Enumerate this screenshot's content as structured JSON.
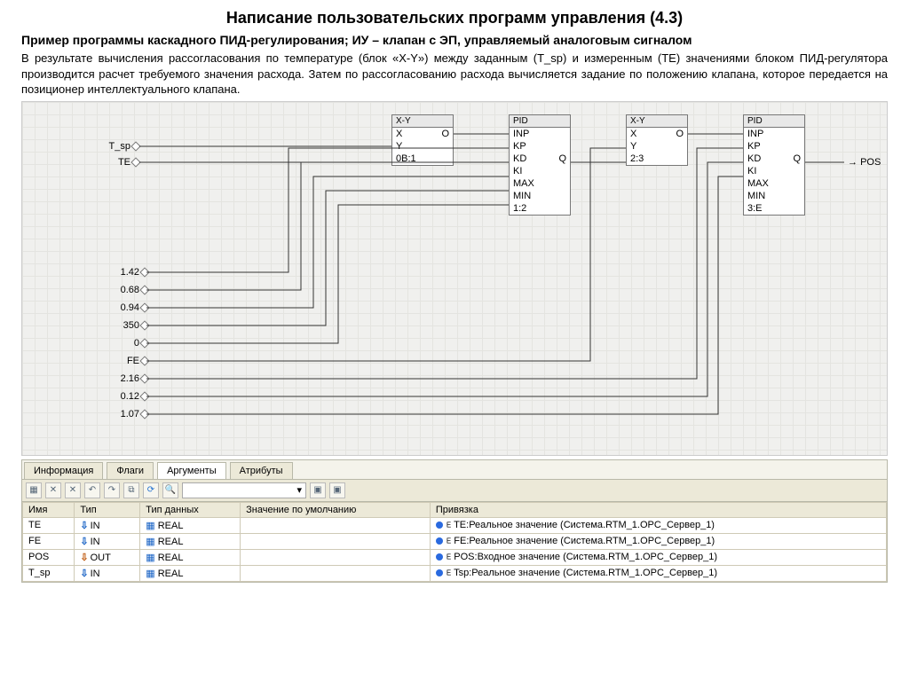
{
  "title": "Написание пользовательских программ управления (4.3)",
  "subtitle": "Пример программы каскадного ПИД-регулирования; ИУ – клапан с ЭП, управляемый аналоговым сигналом",
  "description": "В результате вычисления рассогласования по температуре (блок «X-Y») между заданным (T_sp) и измеренным (TE) значениями блоком ПИД-регулятора производится расчет требуемого значения расхода. Затем по рассогласованию  расхода вычисляется задание по положению клапана, которое передается на позиционер интеллектуального клапана.",
  "inputs_left": [
    "T_sp",
    "TE"
  ],
  "inputs_const": [
    "1.42",
    "0.68",
    "0.94",
    "350",
    "0",
    "FE",
    "2.16",
    "0.12",
    "1.07"
  ],
  "output_label": "POS",
  "blocks": {
    "xy1": {
      "title": "X-Y",
      "pins_l": [
        "X",
        "Y"
      ],
      "pins_r": [
        "O",
        ""
      ],
      "footer": "0B:1"
    },
    "pid1": {
      "title": "PID",
      "pins_l": [
        "INP",
        "KP",
        "KD",
        "KI",
        "MAX",
        "MIN"
      ],
      "pins_r": [
        "",
        "",
        "Q",
        "",
        "",
        ""
      ],
      "footer": "1:2"
    },
    "xy2": {
      "title": "X-Y",
      "pins_l": [
        "X",
        "Y"
      ],
      "pins_r": [
        "O",
        ""
      ],
      "footer": "2:3"
    },
    "pid2": {
      "title": "PID",
      "pins_l": [
        "INP",
        "KP",
        "KD",
        "KI",
        "MAX",
        "MIN"
      ],
      "pins_r": [
        "",
        "",
        "Q",
        "",
        "",
        ""
      ],
      "footer": "3:E"
    }
  },
  "tabs": [
    "Информация",
    "Флаги",
    "Аргументы",
    "Атрибуты"
  ],
  "active_tab": 2,
  "grid_headers": [
    "Имя",
    "Тип",
    "Тип данных",
    "Значение по умолчанию",
    "Привязка"
  ],
  "grid_rows": [
    {
      "name": "TE",
      "dir": "IN",
      "dtype": "REAL",
      "default": "",
      "bind": "TE:Реальное значение (Система.RTM_1.OPC_Сервер_1)"
    },
    {
      "name": "FE",
      "dir": "IN",
      "dtype": "REAL",
      "default": "",
      "bind": "FE:Реальное значение (Система.RTM_1.OPC_Сервер_1)"
    },
    {
      "name": "POS",
      "dir": "OUT",
      "dtype": "REAL",
      "default": "",
      "bind": "POS:Входное значение (Система.RTM_1.OPC_Сервер_1)"
    },
    {
      "name": "T_sp",
      "dir": "IN",
      "dtype": "REAL",
      "default": "",
      "bind": "Tsp:Реальное значение (Система.RTM_1.OPC_Сервер_1)"
    }
  ]
}
